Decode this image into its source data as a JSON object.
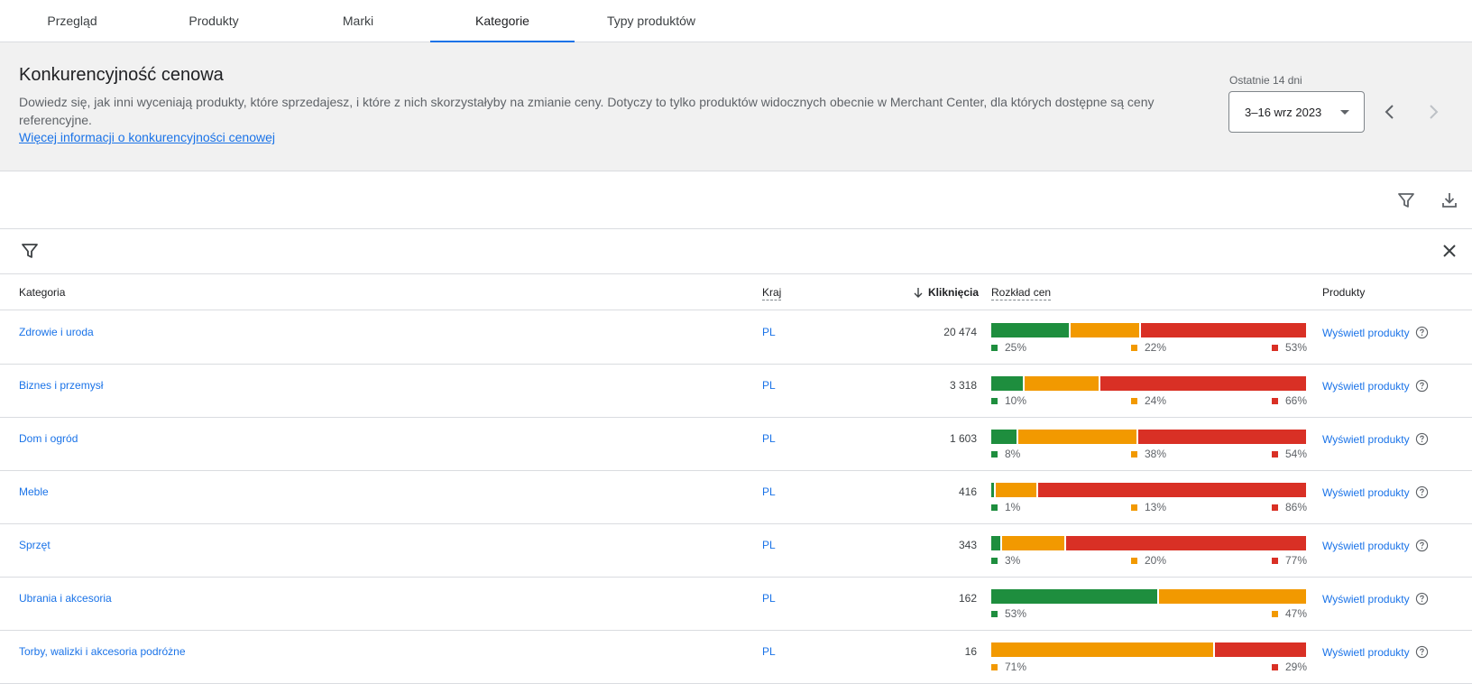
{
  "tabs": [
    {
      "label": "Przegląd",
      "active": false
    },
    {
      "label": "Produkty",
      "active": false
    },
    {
      "label": "Marki",
      "active": false
    },
    {
      "label": "Kategorie",
      "active": true
    },
    {
      "label": "Typy produktów",
      "active": false
    }
  ],
  "header": {
    "title": "Konkurencyjność cenowa",
    "description": "Dowiedz się, jak inni wyceniają produkty, które sprzedajesz, i które z nich skorzystałyby na zmianie ceny. Dotyczy to tylko produktów widocznych obecnie w Merchant Center, dla których dostępne są ceny referencyjne.",
    "link": "Więcej informacji o konkurencyjności cenowej",
    "period_label": "Ostatnie 14 dni",
    "date_range": "3–16 wrz 2023"
  },
  "table": {
    "columns": {
      "category": "Kategoria",
      "country": "Kraj",
      "clicks": "Kliknięcia",
      "price_distribution": "Rozkład cen",
      "products": "Produkty"
    },
    "rows": [
      {
        "category": "Zdrowie i uroda",
        "country": "PL",
        "clicks": "20 474",
        "green": 25,
        "orange": 22,
        "red": 53,
        "products": "Wyświetl produkty"
      },
      {
        "category": "Biznes i przemysł",
        "country": "PL",
        "clicks": "3 318",
        "green": 10,
        "orange": 24,
        "red": 66,
        "products": "Wyświetl produkty"
      },
      {
        "category": "Dom i ogród",
        "country": "PL",
        "clicks": "1 603",
        "green": 8,
        "orange": 38,
        "red": 54,
        "products": "Wyświetl produkty"
      },
      {
        "category": "Meble",
        "country": "PL",
        "clicks": "416",
        "green": 1,
        "orange": 13,
        "red": 86,
        "products": "Wyświetl produkty"
      },
      {
        "category": "Sprzęt",
        "country": "PL",
        "clicks": "343",
        "green": 3,
        "orange": 20,
        "red": 77,
        "products": "Wyświetl produkty"
      },
      {
        "category": "Ubrania i akcesoria",
        "country": "PL",
        "clicks": "162",
        "green": 53,
        "orange": 47,
        "red": null,
        "products": "Wyświetl produkty"
      },
      {
        "category": "Torby, walizki i akcesoria podróżne",
        "country": "PL",
        "clicks": "16",
        "green": null,
        "orange": 71,
        "red": 29,
        "products": "Wyświetl produkty"
      }
    ]
  },
  "colors": {
    "accent": "#1a73e8",
    "green": "#1e8e3e",
    "orange": "#f29900",
    "red": "#d93025"
  },
  "icons": {
    "toolbar": [
      "filter-icon",
      "download-icon"
    ],
    "filterbar": [
      "filter-icon",
      "close-icon"
    ],
    "date_nav": [
      "chevron-left-icon",
      "chevron-right-icon"
    ],
    "row": "help-circle-icon"
  }
}
